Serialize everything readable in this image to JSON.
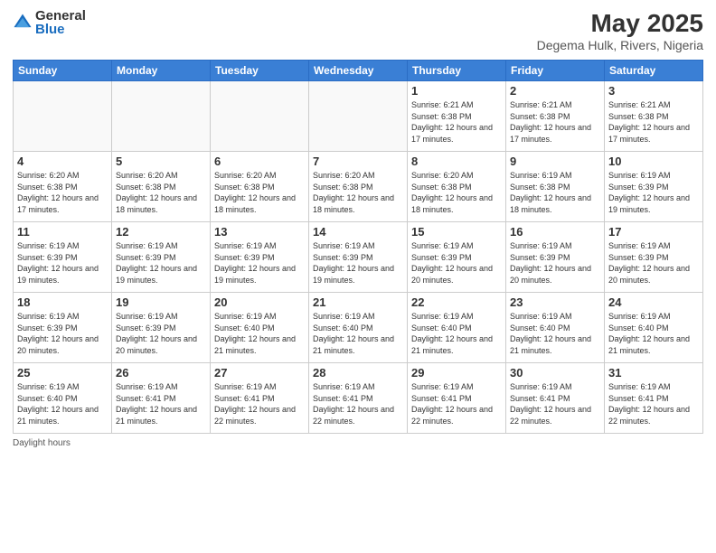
{
  "logo": {
    "general": "General",
    "blue": "Blue"
  },
  "title": "May 2025",
  "subtitle": "Degema Hulk, Rivers, Nigeria",
  "days_of_week": [
    "Sunday",
    "Monday",
    "Tuesday",
    "Wednesday",
    "Thursday",
    "Friday",
    "Saturday"
  ],
  "footer": "Daylight hours",
  "weeks": [
    [
      {
        "day": "",
        "info": ""
      },
      {
        "day": "",
        "info": ""
      },
      {
        "day": "",
        "info": ""
      },
      {
        "day": "",
        "info": ""
      },
      {
        "day": "1",
        "info": "Sunrise: 6:21 AM\nSunset: 6:38 PM\nDaylight: 12 hours and 17 minutes."
      },
      {
        "day": "2",
        "info": "Sunrise: 6:21 AM\nSunset: 6:38 PM\nDaylight: 12 hours and 17 minutes."
      },
      {
        "day": "3",
        "info": "Sunrise: 6:21 AM\nSunset: 6:38 PM\nDaylight: 12 hours and 17 minutes."
      }
    ],
    [
      {
        "day": "4",
        "info": "Sunrise: 6:20 AM\nSunset: 6:38 PM\nDaylight: 12 hours and 17 minutes."
      },
      {
        "day": "5",
        "info": "Sunrise: 6:20 AM\nSunset: 6:38 PM\nDaylight: 12 hours and 18 minutes."
      },
      {
        "day": "6",
        "info": "Sunrise: 6:20 AM\nSunset: 6:38 PM\nDaylight: 12 hours and 18 minutes."
      },
      {
        "day": "7",
        "info": "Sunrise: 6:20 AM\nSunset: 6:38 PM\nDaylight: 12 hours and 18 minutes."
      },
      {
        "day": "8",
        "info": "Sunrise: 6:20 AM\nSunset: 6:38 PM\nDaylight: 12 hours and 18 minutes."
      },
      {
        "day": "9",
        "info": "Sunrise: 6:19 AM\nSunset: 6:38 PM\nDaylight: 12 hours and 18 minutes."
      },
      {
        "day": "10",
        "info": "Sunrise: 6:19 AM\nSunset: 6:39 PM\nDaylight: 12 hours and 19 minutes."
      }
    ],
    [
      {
        "day": "11",
        "info": "Sunrise: 6:19 AM\nSunset: 6:39 PM\nDaylight: 12 hours and 19 minutes."
      },
      {
        "day": "12",
        "info": "Sunrise: 6:19 AM\nSunset: 6:39 PM\nDaylight: 12 hours and 19 minutes."
      },
      {
        "day": "13",
        "info": "Sunrise: 6:19 AM\nSunset: 6:39 PM\nDaylight: 12 hours and 19 minutes."
      },
      {
        "day": "14",
        "info": "Sunrise: 6:19 AM\nSunset: 6:39 PM\nDaylight: 12 hours and 19 minutes."
      },
      {
        "day": "15",
        "info": "Sunrise: 6:19 AM\nSunset: 6:39 PM\nDaylight: 12 hours and 20 minutes."
      },
      {
        "day": "16",
        "info": "Sunrise: 6:19 AM\nSunset: 6:39 PM\nDaylight: 12 hours and 20 minutes."
      },
      {
        "day": "17",
        "info": "Sunrise: 6:19 AM\nSunset: 6:39 PM\nDaylight: 12 hours and 20 minutes."
      }
    ],
    [
      {
        "day": "18",
        "info": "Sunrise: 6:19 AM\nSunset: 6:39 PM\nDaylight: 12 hours and 20 minutes."
      },
      {
        "day": "19",
        "info": "Sunrise: 6:19 AM\nSunset: 6:39 PM\nDaylight: 12 hours and 20 minutes."
      },
      {
        "day": "20",
        "info": "Sunrise: 6:19 AM\nSunset: 6:40 PM\nDaylight: 12 hours and 21 minutes."
      },
      {
        "day": "21",
        "info": "Sunrise: 6:19 AM\nSunset: 6:40 PM\nDaylight: 12 hours and 21 minutes."
      },
      {
        "day": "22",
        "info": "Sunrise: 6:19 AM\nSunset: 6:40 PM\nDaylight: 12 hours and 21 minutes."
      },
      {
        "day": "23",
        "info": "Sunrise: 6:19 AM\nSunset: 6:40 PM\nDaylight: 12 hours and 21 minutes."
      },
      {
        "day": "24",
        "info": "Sunrise: 6:19 AM\nSunset: 6:40 PM\nDaylight: 12 hours and 21 minutes."
      }
    ],
    [
      {
        "day": "25",
        "info": "Sunrise: 6:19 AM\nSunset: 6:40 PM\nDaylight: 12 hours and 21 minutes."
      },
      {
        "day": "26",
        "info": "Sunrise: 6:19 AM\nSunset: 6:41 PM\nDaylight: 12 hours and 21 minutes."
      },
      {
        "day": "27",
        "info": "Sunrise: 6:19 AM\nSunset: 6:41 PM\nDaylight: 12 hours and 22 minutes."
      },
      {
        "day": "28",
        "info": "Sunrise: 6:19 AM\nSunset: 6:41 PM\nDaylight: 12 hours and 22 minutes."
      },
      {
        "day": "29",
        "info": "Sunrise: 6:19 AM\nSunset: 6:41 PM\nDaylight: 12 hours and 22 minutes."
      },
      {
        "day": "30",
        "info": "Sunrise: 6:19 AM\nSunset: 6:41 PM\nDaylight: 12 hours and 22 minutes."
      },
      {
        "day": "31",
        "info": "Sunrise: 6:19 AM\nSunset: 6:41 PM\nDaylight: 12 hours and 22 minutes."
      }
    ]
  ]
}
